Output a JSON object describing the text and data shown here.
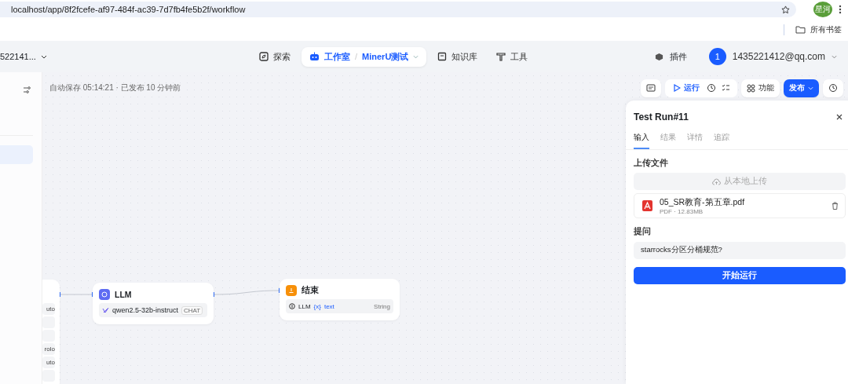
{
  "browser": {
    "url": "localhost/app/8f2fcefe-af97-484f-ac39-7d7fb4fe5b2f/workflow",
    "profile": "星河",
    "bookmarks_label": "所有书签"
  },
  "header": {
    "workspace": "522141...",
    "nav": [
      {
        "label": "探索",
        "selected": false
      },
      {
        "label": "工作室",
        "selected": true,
        "separator": "/",
        "app": "MinerU测试"
      },
      {
        "label": "知识库",
        "selected": false
      },
      {
        "label": "工具",
        "selected": false
      }
    ],
    "plugins": "插件",
    "avatar": "1",
    "email": "1435221412@qq.com"
  },
  "toolbar": {
    "autosave": "自动保存 05:14:21 · 已发布 10 分钟前",
    "run": "运行",
    "features": "功能",
    "publish": "发布"
  },
  "nodes": [
    {
      "kind": "partial",
      "rows": [
        "uto",
        "",
        "",
        "rolo",
        "uto",
        ""
      ]
    },
    {
      "kind": "llm",
      "title": "LLM",
      "model": "qwen2.5-32b-instruct",
      "tag": "CHAT"
    },
    {
      "kind": "end",
      "title": "结束",
      "var_source": "LLM",
      "var_marker": "{x}",
      "var_name": "text",
      "var_type": "String"
    }
  ],
  "panel": {
    "title": "Test Run#11",
    "tabs": [
      {
        "label": "输入",
        "selected": true
      },
      {
        "label": "结果",
        "selected": false
      },
      {
        "label": "详情",
        "selected": false
      },
      {
        "label": "追踪",
        "selected": false
      }
    ],
    "upload_label": "上传文件",
    "upload_button": "从本地上传",
    "file": {
      "name": "05_SR教育-第五章.pdf",
      "meta": "PDF · 12.83MB"
    },
    "question_label": "提问",
    "question_value": "starrocks分区分桶规范?",
    "start": "开始运行"
  }
}
